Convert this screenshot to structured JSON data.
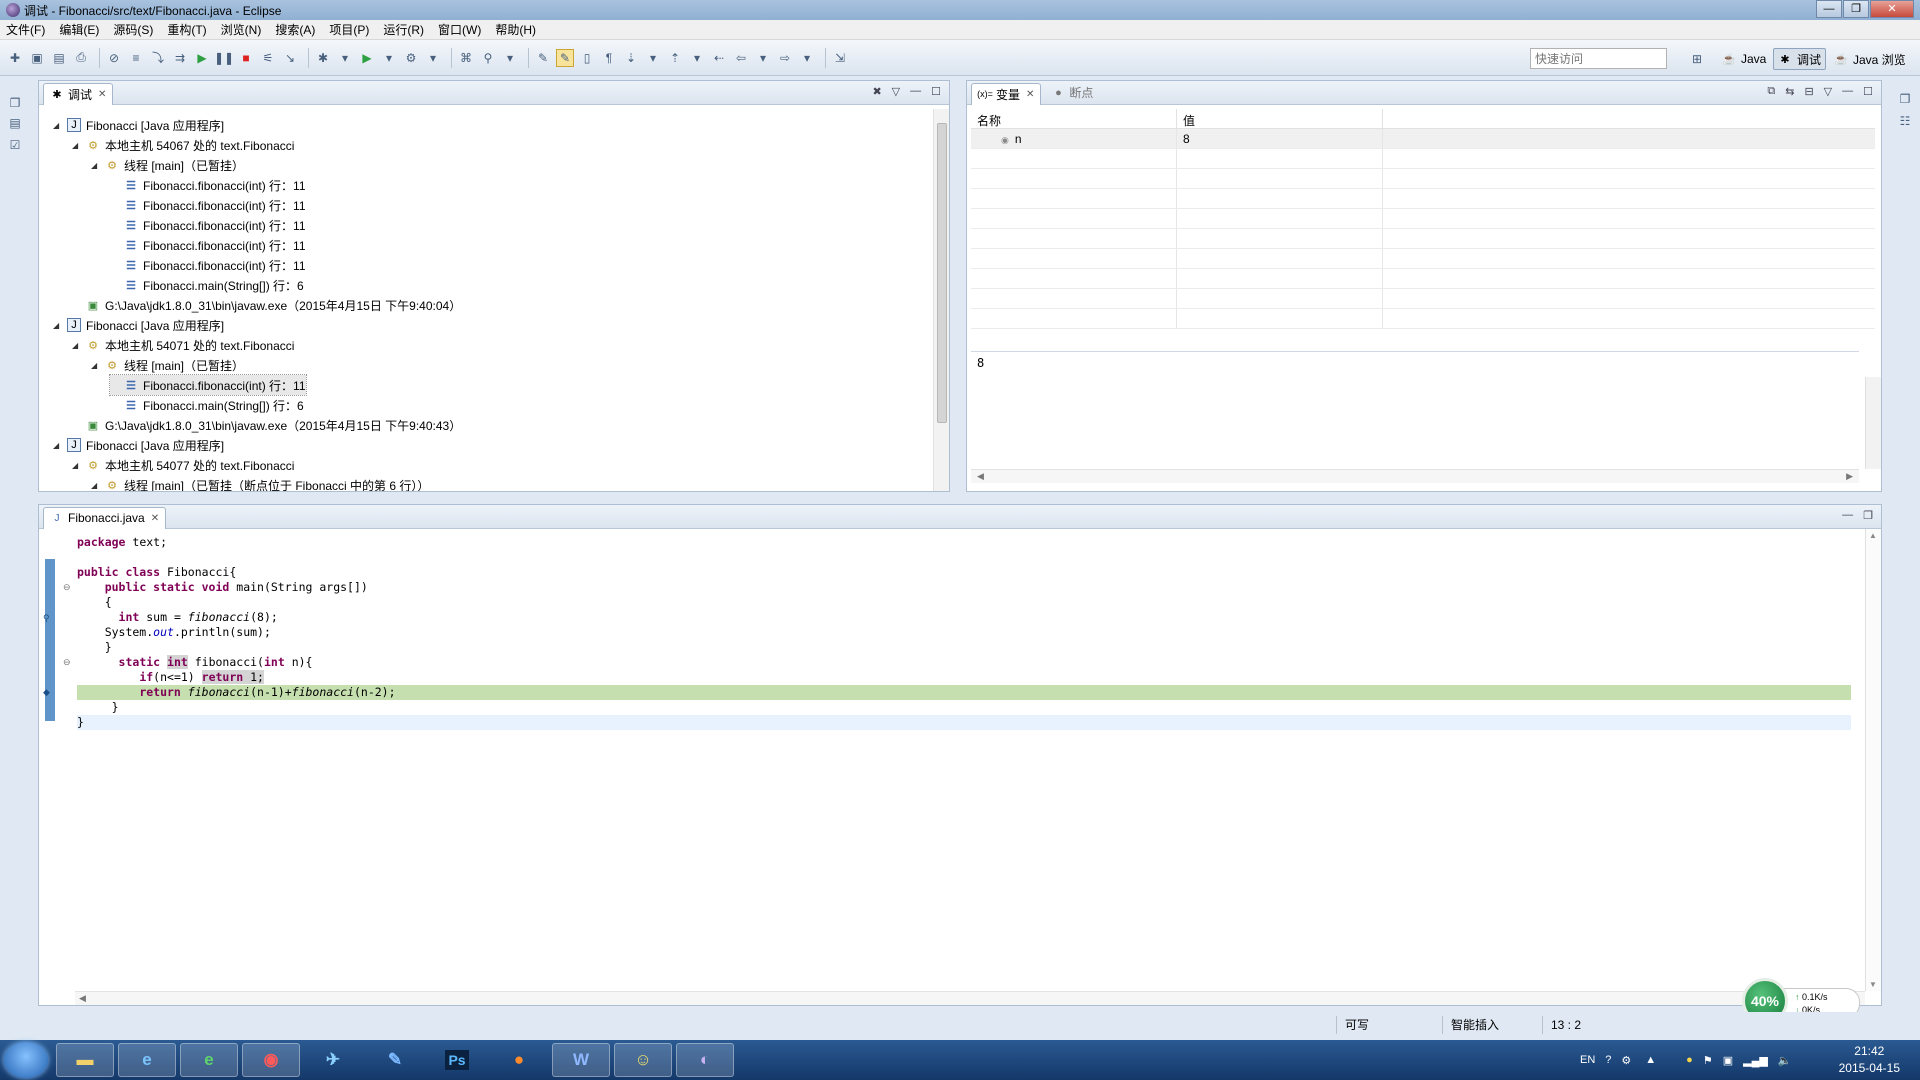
{
  "window": {
    "title": "调试 - Fibonacci/src/text/Fibonacci.java - Eclipse"
  },
  "menu": [
    "文件(F)",
    "编辑(E)",
    "源码(S)",
    "重构(T)",
    "浏览(N)",
    "搜索(A)",
    "项目(P)",
    "运行(R)",
    "窗口(W)",
    "帮助(H)"
  ],
  "toolbar": {
    "quick_access_placeholder": "快速访问",
    "perspectives": [
      "Java",
      "调试",
      "Java 浏览"
    ]
  },
  "debug_view": {
    "tab_label": "调试",
    "rows": [
      {
        "label": "Fibonacci [Java 应用程序]",
        "icon": "app-icon",
        "depth": 0,
        "expanded": true
      },
      {
        "label": "本地主机 54067 处的 text.Fibonacci",
        "icon": "vm-icon",
        "depth": 1,
        "expanded": true
      },
      {
        "label": "线程 [main]（已暂挂）",
        "icon": "thread-icon",
        "depth": 2,
        "expanded": true
      },
      {
        "label": "Fibonacci.fibonacci(int) 行：11",
        "icon": "stack-frame-icon",
        "depth": 3
      },
      {
        "label": "Fibonacci.fibonacci(int) 行：11",
        "icon": "stack-frame-icon",
        "depth": 3
      },
      {
        "label": "Fibonacci.fibonacci(int) 行：11",
        "icon": "stack-frame-icon",
        "depth": 3
      },
      {
        "label": "Fibonacci.fibonacci(int) 行：11",
        "icon": "stack-frame-icon",
        "depth": 3
      },
      {
        "label": "Fibonacci.fibonacci(int) 行：11",
        "icon": "stack-frame-icon",
        "depth": 3
      },
      {
        "label": "Fibonacci.main(String[]) 行：6",
        "icon": "stack-frame-icon",
        "depth": 3
      },
      {
        "label": "G:\\Java\\jdk1.8.0_31\\bin\\javaw.exe（2015年4月15日 下午9:40:04）",
        "icon": "process-icon",
        "depth": 1
      },
      {
        "label": "Fibonacci [Java 应用程序]",
        "icon": "app-icon",
        "depth": 0,
        "expanded": true
      },
      {
        "label": "本地主机 54071 处的 text.Fibonacci",
        "icon": "vm-icon",
        "depth": 1,
        "expanded": true
      },
      {
        "label": "线程 [main]（已暂挂）",
        "icon": "thread-icon",
        "depth": 2,
        "expanded": true
      },
      {
        "label": "Fibonacci.fibonacci(int) 行：11",
        "icon": "stack-frame-icon",
        "depth": 3,
        "selected": true
      },
      {
        "label": "Fibonacci.main(String[]) 行：6",
        "icon": "stack-frame-icon",
        "depth": 3
      },
      {
        "label": "G:\\Java\\jdk1.8.0_31\\bin\\javaw.exe（2015年4月15日 下午9:40:43）",
        "icon": "process-icon",
        "depth": 1
      },
      {
        "label": "Fibonacci [Java 应用程序]",
        "icon": "app-icon",
        "depth": 0,
        "expanded": true
      },
      {
        "label": "本地主机 54077 处的 text.Fibonacci",
        "icon": "vm-icon",
        "depth": 1,
        "expanded": true
      },
      {
        "label": "线程 [main]（已暂挂（断点位于 Fibonacci 中的第 6 行））",
        "icon": "thread-icon",
        "depth": 2,
        "expanded": true
      }
    ]
  },
  "variables_view": {
    "tab_label": "变量",
    "breakpoints_tab_label": "断点",
    "columns": [
      "名称",
      "值"
    ],
    "rows": [
      {
        "name": "n",
        "value": "8"
      }
    ],
    "detail_text": "8"
  },
  "editor": {
    "tab_label": "Fibonacci.java",
    "lines": [
      "package text;",
      "",
      "public class Fibonacci{",
      "    public static void main(String args[])",
      "    {",
      "      int sum = fibonacci(8);",
      "    System.out.println(sum);",
      "    }",
      "      static int fibonacci(int n){",
      "         if(n<=1) return 1;",
      "         return fibonacci(n-1)+fibonacci(n-2);",
      "     }",
      "}"
    ],
    "highlighted_line": 11,
    "cursor_line": 13
  },
  "status": {
    "writable": "可写",
    "insert_mode": "智能插入",
    "position": "13 : 2"
  },
  "net_widget": {
    "percent": "40%",
    "up": "0.1K/s",
    "down": "0K/s"
  },
  "taskbar": {
    "apps": [
      "file-explorer-icon",
      "ie-icon",
      "ie-green-icon",
      "netease-music-icon",
      "feiq-icon",
      "edit-icon",
      "photoshop-icon",
      "firefox-icon",
      "word-icon",
      "qq-icon",
      "eclipse-icon"
    ],
    "lang": "EN",
    "time": "21:42",
    "date": "2015-04-15"
  },
  "colors": {
    "highlight_green": "#c5dfaf",
    "keyword": "#7f0055",
    "field": "#0000c0"
  }
}
